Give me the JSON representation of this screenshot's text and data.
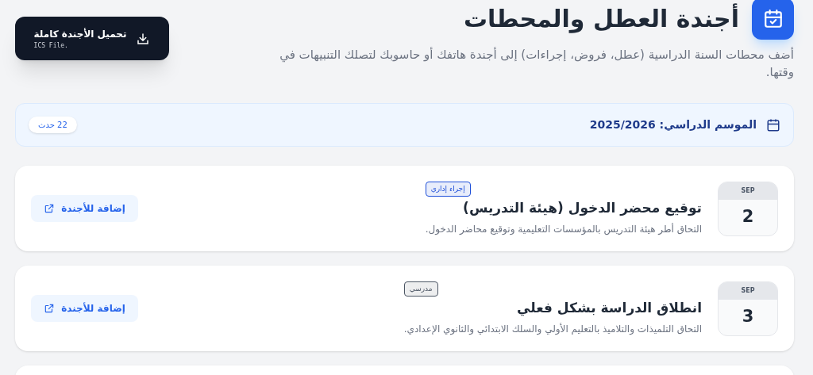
{
  "header": {
    "title": "أجندة العطل والمحطات",
    "description": "أضف محطات السنة الدراسية (عطل، فروض، إجراءات) إلى أجندة هاتفك أو حاسوبك لتصلك التنبيهات في وقتها."
  },
  "download_button": {
    "label": "تحميل الأجندة كاملة",
    "sublabel": "ICS File."
  },
  "season": {
    "label": "الموسم الدراسي: 2025/2026",
    "count": "22 حدث"
  },
  "events": [
    {
      "month": "SEP",
      "day": "2",
      "tag": "إجراء إداري",
      "color": "#1d4ed8",
      "title": "توقيع محضر الدخول (هيئة التدريس)",
      "description": "التحاق أطر هيئة التدريس بالمؤسسات التعليمية وتوقيع محاضر الدخول.",
      "button": "إضافة للأجندة"
    },
    {
      "month": "SEP",
      "day": "3",
      "tag": "مدرسي",
      "color": "#4b5563",
      "title": "انطلاق الدراسة بشكل فعلي",
      "description": "التحاق التلميذات والتلاميذ بالتعليم الأولي والسلك الابتدائي والثانوي الإعدادي.",
      "button": "إضافة للأجندة"
    }
  ]
}
